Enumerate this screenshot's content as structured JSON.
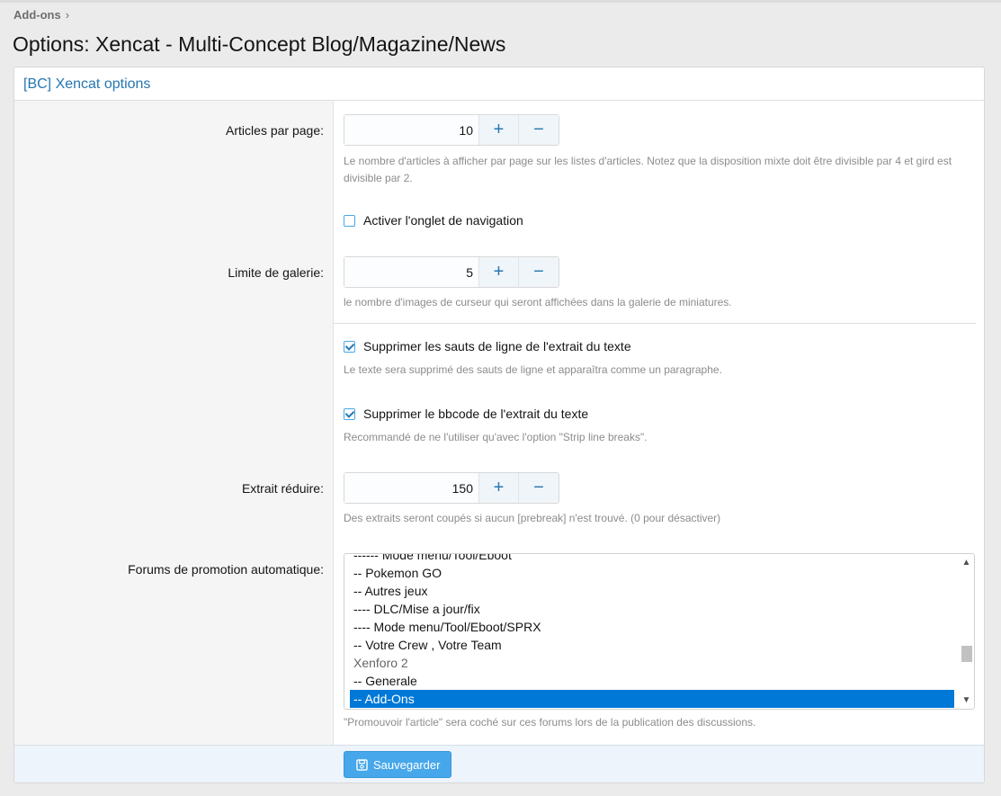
{
  "breadcrumb": {
    "item": "Add-ons",
    "separator": "›"
  },
  "page_title": "Options: Xencat - Multi-Concept Blog/Magazine/News",
  "block_title": "[BC] Xencat options",
  "fields": {
    "articles_per_page": {
      "label": "Articles par page:",
      "value": "10",
      "hint": "Le nombre d'articles à afficher par page sur les listes d'articles. Notez que la disposition mixte doit être divisible par 4 et gird est divisible par 2."
    },
    "nav_tab": {
      "label": "Activer l'onglet de navigation",
      "checked": false
    },
    "gallery_limit": {
      "label": "Limite de galerie:",
      "value": "5",
      "hint": "le nombre d'images de curseur qui seront affichées dans la galerie de miniatures."
    },
    "strip_line_breaks": {
      "label": "Supprimer les sauts de ligne de l'extrait du texte",
      "checked": true,
      "hint": "Le texte sera supprimé des sauts de ligne et apparaîtra comme un paragraphe."
    },
    "strip_bbcode": {
      "label": "Supprimer le bbcode de l'extrait du texte",
      "checked": true,
      "hint": "Recommandé de ne l'utiliser qu'avec l'option \"Strip line breaks\"."
    },
    "excerpt_trim": {
      "label": "Extrait réduire:",
      "value": "150",
      "hint": "Des extraits seront coupés si aucun [prebreak] n'est trouvé. (0 pour désactiver)"
    },
    "auto_promote_forums": {
      "label": "Forums de promotion automatique:",
      "options": [
        "------ Mode menu/Tool/Eboot",
        "-- Pokemon GO",
        "-- Autres jeux",
        "---- DLC/Mise a jour/fix",
        "---- Mode menu/Tool/Eboot/SPRX",
        "-- Votre Crew , Votre Team",
        "Xenforo 2",
        "-- Generale",
        "-- Add-Ons"
      ],
      "selected": "-- Add-Ons",
      "group_option": "Xenforo 2",
      "hint": "\"Promouvoir l'article\" sera coché sur ces forums lors de la publication des discussions."
    }
  },
  "stepper": {
    "plus": "+",
    "minus": "−"
  },
  "save_button": {
    "label": "Sauvegarder",
    "icon": "save-icon"
  },
  "colors": {
    "accent": "#47a7eb",
    "link": "#2577b1",
    "selected": "#0078d7"
  }
}
